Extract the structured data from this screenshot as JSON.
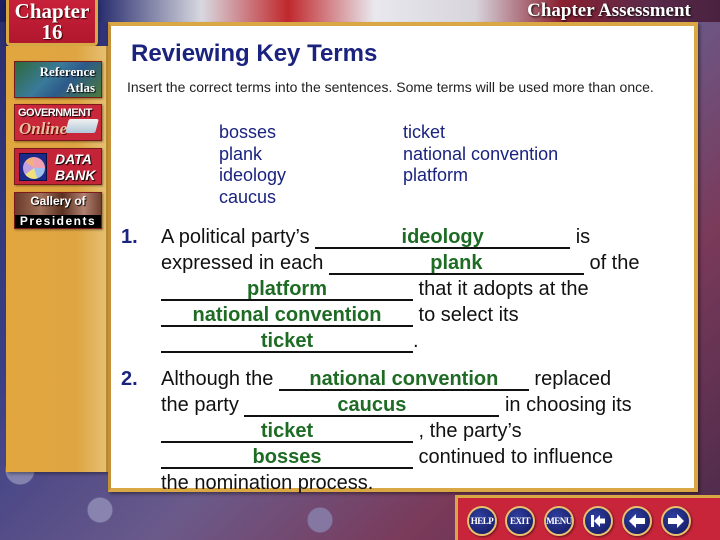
{
  "header": {
    "chapter_word": "Chapter",
    "chapter_number": "16",
    "assessment_title": "Chapter Assessment"
  },
  "sidebar": {
    "items": [
      {
        "name": "reference-atlas",
        "line1": "Reference",
        "line2": "Atlas"
      },
      {
        "name": "government-online",
        "line1": "GOVERNMENT",
        "line2": "Online"
      },
      {
        "name": "data-bank",
        "line1": "DATA",
        "line2": "BANK"
      },
      {
        "name": "gallery-of-presidents",
        "line1": "Gallery of",
        "line2": "Presidents"
      }
    ]
  },
  "main": {
    "title": "Reviewing Key Terms",
    "instructions": "Insert the correct terms into the sentences. Some terms will be used more than once.",
    "terms_col1": [
      "bosses",
      "plank",
      "ideology",
      "caucus"
    ],
    "terms_col2": [
      "ticket",
      "national convention",
      "platform"
    ],
    "questions": [
      {
        "number": "1.",
        "lines": [
          {
            "pre": "A political party’s ",
            "answer": "ideology",
            "post": " is"
          },
          {
            "pre": "expressed in each ",
            "answer": "plank",
            "post": " of the"
          },
          {
            "pre": "",
            "answer": "platform",
            "post": " that it adopts at the"
          },
          {
            "pre": "",
            "answer": "national convention",
            "post": " to select its"
          },
          {
            "pre": "",
            "answer": "ticket",
            "post": "."
          }
        ]
      },
      {
        "number": "2.",
        "lines": [
          {
            "pre": "Although the ",
            "answer": "national convention",
            "post": " replaced"
          },
          {
            "pre": "the party ",
            "answer": "caucus",
            "post": " in choosing its"
          },
          {
            "pre": "",
            "answer": "ticket",
            "post": " , the party’s"
          },
          {
            "pre": "",
            "answer": "bosses",
            "post": " continued to influence"
          },
          {
            "pre": "the nomination process.",
            "answer": null,
            "post": ""
          }
        ]
      }
    ]
  },
  "nav": {
    "help": "HELP",
    "exit": "EXIT",
    "menu": "MENU",
    "first_icon": "first-page-icon",
    "prev_icon": "arrow-left-icon",
    "next_icon": "arrow-right-icon"
  },
  "colors": {
    "title_blue": "#1a237e",
    "answer_green": "#1e6b24",
    "frame_gold": "#d9a845",
    "nav_red": "#c8253a"
  }
}
